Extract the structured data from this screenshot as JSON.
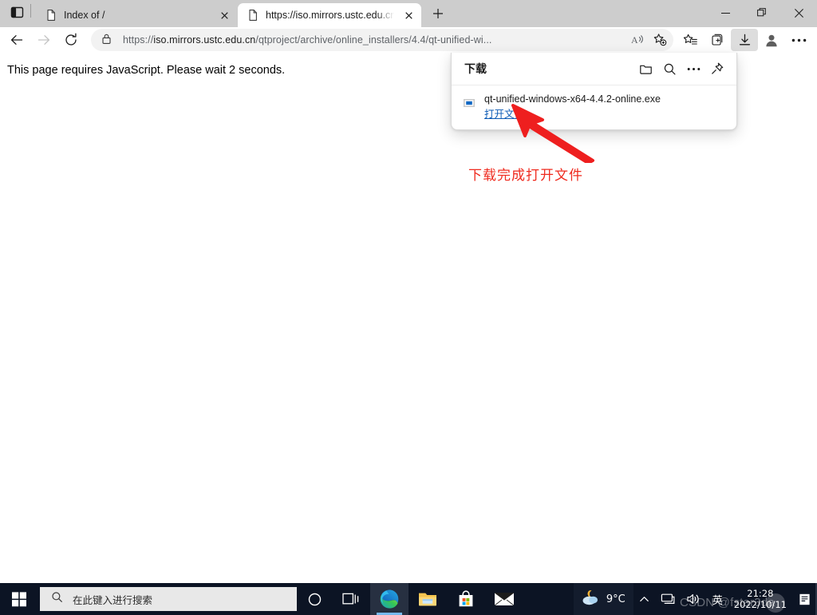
{
  "window": {
    "controls": {
      "minimize": "—",
      "restore": "❐",
      "close": "✕"
    }
  },
  "tabstrip": {
    "tab_list_icon": "tab-list-icon",
    "new_tab_label": "+",
    "tabs": [
      {
        "title": "Index of /",
        "active": false,
        "favicon": "page-icon",
        "close": "✕"
      },
      {
        "title": "https://iso.mirrors.ustc.edu.cn/qt",
        "active": true,
        "favicon": "page-icon",
        "close": "✕"
      }
    ]
  },
  "toolbar": {
    "back": "back-arrow",
    "forward": "forward-arrow",
    "refresh": "refresh-icon",
    "url_prefix": "https://",
    "url_host": "iso.mirrors.ustc.edu.cn",
    "url_path": "/qtproject/archive/online_installers/4.4/qt-unified-wi...",
    "url_full": "https://iso.mirrors.ustc.edu.cn/qtproject/archive/online_installers/4.4/qt-unified-wi...",
    "read_aloud": "read-aloud-icon",
    "add_favorite": "add-favorite-icon",
    "favorites": "favorites-icon",
    "collections": "collections-icon",
    "downloads": "downloads-icon",
    "profile": "profile-icon",
    "settings": "more-settings-icon"
  },
  "page": {
    "body_text": "This page requires JavaScript. Please wait 2 seconds."
  },
  "downloads_flyout": {
    "title": "下载",
    "actions": {
      "open_folder": "folder-icon",
      "search": "search-icon",
      "more": "more-options-icon",
      "pin": "pin-icon"
    },
    "items": [
      {
        "filename": "qt-unified-windows-x64-4.4.2-online.exe",
        "action_label": "打开文件",
        "icon": "exe-file-icon"
      }
    ]
  },
  "annotation": {
    "text": "下载完成打开文件",
    "color": "#ef2b1f",
    "arrow": "red-arrow-up-left"
  },
  "taskbar": {
    "start": "windows-start-icon",
    "search": {
      "placeholder": "在此键入进行搜索",
      "icon": "search-icon"
    },
    "cortana": "cortana-circle-icon",
    "apps": [
      {
        "name": "task-view-icon",
        "running": false
      },
      {
        "name": "microsoft-edge-icon",
        "running": true
      },
      {
        "name": "file-explorer-icon",
        "running": false
      },
      {
        "name": "microsoft-store-icon",
        "running": false
      },
      {
        "name": "mail-icon",
        "running": false
      }
    ],
    "weather": {
      "temperature": "9°C",
      "icon": "night-cloud-icon"
    },
    "tray": {
      "chevron": "show-hidden-icons-chevron",
      "network": "network-icon",
      "volume": "volume-icon",
      "ime": "英"
    },
    "clock": {
      "time": "21:28",
      "date": "2022/10/11"
    },
    "notifications": "notification-center-icon"
  },
  "watermark": {
    "text": "CSDN @fstar3da"
  }
}
